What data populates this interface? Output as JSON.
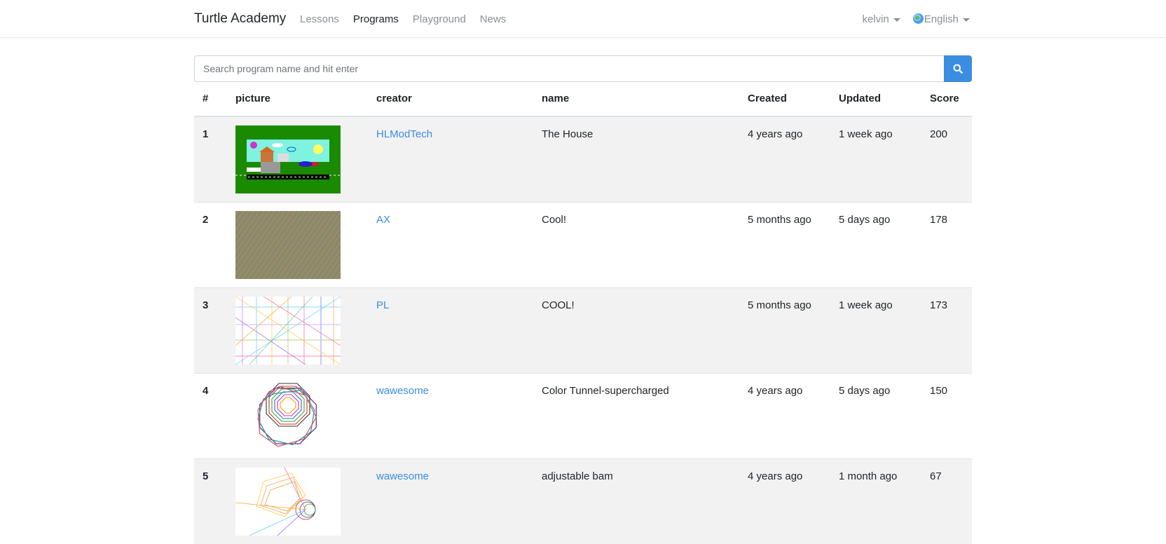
{
  "nav": {
    "brand": "Turtle Academy",
    "links": [
      {
        "label": "Lessons",
        "active": false
      },
      {
        "label": "Programs",
        "active": true
      },
      {
        "label": "Playground",
        "active": false
      },
      {
        "label": "News",
        "active": false
      }
    ],
    "user": "kelvin",
    "language": "English"
  },
  "search": {
    "placeholder": "Search program name and hit enter",
    "icon": "search-icon"
  },
  "table": {
    "headers": [
      "#",
      "picture",
      "creator",
      "name",
      "Created",
      "Updated",
      "Score"
    ],
    "rows": [
      {
        "rank": "1",
        "creator": "HLModTech",
        "name": "The House",
        "created": "4 years ago",
        "updated": "1 week ago",
        "score": "200"
      },
      {
        "rank": "2",
        "creator": "AX",
        "name": "Cool!",
        "created": "5 months ago",
        "updated": "5 days ago",
        "score": "178"
      },
      {
        "rank": "3",
        "creator": "PL",
        "name": "COOL!",
        "created": "5 months ago",
        "updated": "1 week ago",
        "score": "173"
      },
      {
        "rank": "4",
        "creator": "wawesome",
        "name": "Color Tunnel-supercharged",
        "created": "4 years ago",
        "updated": "5 days ago",
        "score": "150"
      },
      {
        "rank": "5",
        "creator": "wawesome",
        "name": "adjustable bam",
        "created": "4 years ago",
        "updated": "1 month ago",
        "score": "67"
      }
    ]
  },
  "colors": {
    "accent": "#3a8de0",
    "row_stripe": "#f2f2f2"
  }
}
